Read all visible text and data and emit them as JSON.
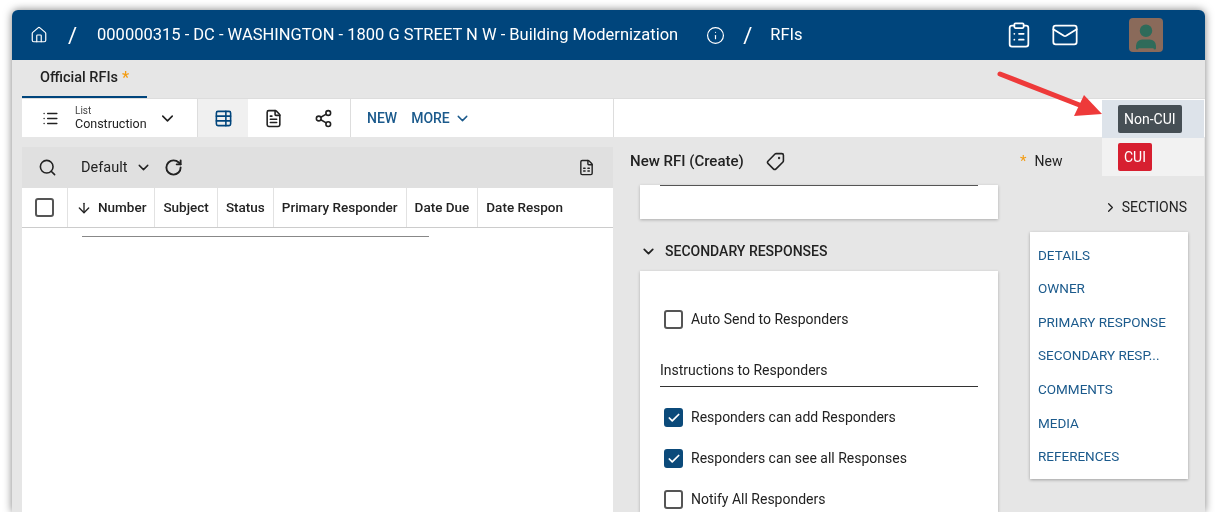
{
  "header": {
    "project": "000000315 - DC - WASHINGTON - 1800 G STREET N W - Building Modernization",
    "separator": "/",
    "page": "RFIs"
  },
  "tabs": [
    {
      "label": "Official RFIs",
      "marker": "*",
      "selected": true
    }
  ],
  "toolbar": {
    "view_label": "List",
    "view_value": "Construction",
    "views": [
      {
        "kind": "list",
        "selected": true
      },
      {
        "kind": "document",
        "selected": false
      },
      {
        "kind": "share",
        "selected": false
      }
    ],
    "new": "NEW",
    "more": "MORE"
  },
  "grid": {
    "filter": "Default",
    "select_all": false,
    "columns": [
      {
        "label": "Number",
        "sorted": true
      },
      {
        "label": "Subject",
        "sorted": false
      },
      {
        "label": "Status",
        "sorted": false
      },
      {
        "label": "Primary Responder",
        "sorted": false
      },
      {
        "label": "Date Due",
        "sorted": false
      },
      {
        "label": "Date Respon",
        "sorted": false
      }
    ]
  },
  "form": {
    "title": "New RFI (Create)",
    "status_marker": "*",
    "status": "New",
    "section": {
      "title": "SECONDARY RESPONSES",
      "expanded": true,
      "items": [
        {
          "kind": "checkbox",
          "label": "Auto Send to Responders",
          "checked": false
        },
        {
          "kind": "heading",
          "label": "Instructions to Responders"
        },
        {
          "kind": "checkbox",
          "label": "Responders can add Responders",
          "checked": true
        },
        {
          "kind": "checkbox",
          "label": "Responders can see all Responses",
          "checked": true
        },
        {
          "kind": "checkbox",
          "label": "Notify All Responders",
          "checked": false
        }
      ]
    }
  },
  "sections_nav": {
    "title": "SECTIONS",
    "expanded": false,
    "items": [
      "DETAILS",
      "OWNER",
      "PRIMARY RESPONSE",
      "SECONDARY RESP...",
      "COMMENTS",
      "MEDIA",
      "REFERENCES"
    ]
  },
  "classification_menu": {
    "items": [
      {
        "label": "Non-CUI",
        "color": "#464f55",
        "selected": true
      },
      {
        "label": "CUI",
        "color": "#d71f30",
        "selected": false
      }
    ]
  }
}
